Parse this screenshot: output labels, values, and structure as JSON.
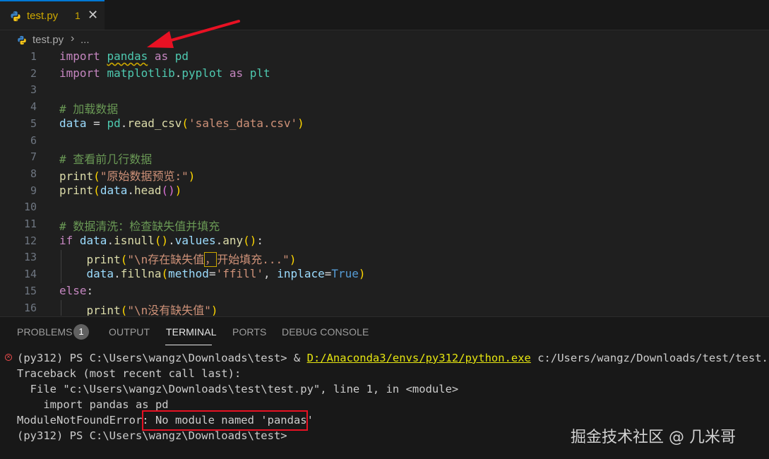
{
  "tab": {
    "filename": "test.py",
    "problem_count": "1",
    "close_glyph": "✕"
  },
  "breadcrumb": {
    "file": "test.py",
    "separator": "›",
    "more": "..."
  },
  "editor": {
    "line_numbers": [
      "1",
      "2",
      "3",
      "4",
      "5",
      "6",
      "7",
      "8",
      "9",
      "10",
      "11",
      "12",
      "13",
      "14",
      "15",
      "16"
    ],
    "lines": {
      "l1": [
        "import",
        " ",
        "pandas",
        " ",
        "as",
        " ",
        "pd"
      ],
      "l2": [
        "import",
        " ",
        "matplotlib",
        ".",
        "pyplot",
        " ",
        "as",
        " ",
        "plt"
      ],
      "l4": "# 加载数据",
      "l5": [
        "data",
        " = ",
        "pd",
        ".",
        "read_csv",
        "(",
        "'sales_data.csv'",
        ")"
      ],
      "l7": "# 查看前几行数据",
      "l8": [
        "print",
        "(",
        "\"原始数据预览:\"",
        ")"
      ],
      "l9": [
        "print",
        "(",
        "data",
        ".",
        "head",
        "()",
        ")"
      ],
      "l11": "# 数据清洗：检查缺失值并填充",
      "l12": [
        "if",
        " ",
        "data",
        ".",
        "isnull",
        "()",
        ".",
        "values",
        ".",
        "any",
        "()",
        ":"
      ],
      "l13": [
        "    ",
        "print",
        "(",
        "\"\\n存在缺失值",
        "，",
        "开始填充...\"",
        ")"
      ],
      "l14": [
        "    ",
        "data",
        ".",
        "fillna",
        "(",
        "method",
        "=",
        "'ffill'",
        ", ",
        "inplace",
        "=",
        "True",
        ")"
      ],
      "l15": [
        "else",
        ":"
      ],
      "l16": [
        "    ",
        "print",
        "(",
        "\"\\n没有缺失值\"",
        ")"
      ]
    }
  },
  "panel": {
    "tabs": [
      "PROBLEMS",
      "OUTPUT",
      "TERMINAL",
      "PORTS",
      "DEBUG CONSOLE"
    ],
    "problems_badge": "1",
    "active_tab": "TERMINAL"
  },
  "terminal": {
    "prompt1": "(py312) PS C:\\Users\\wangz\\Downloads\\test> & ",
    "python_path": "D:/Anaconda3/envs/py312/python.exe",
    "script_arg": " c:/Users/wangz/Downloads/test/test.py",
    "traceback": "Traceback (most recent call last):",
    "file_line": "  File \"c:\\Users\\wangz\\Downloads\\test\\test.py\", line 1, in <module>",
    "code_line": "    import pandas as pd",
    "error_type": "ModuleNotFoundError:",
    "error_msg": " No module named 'pandas'",
    "prompt2": "(py312) PS C:\\Users\\wangz\\Downloads\\test>"
  },
  "watermark": "掘金技术社区 @ 几米哥",
  "colors": {
    "accent": "#0078d4",
    "warning": "#cca700",
    "annotation_red": "#e81123"
  }
}
